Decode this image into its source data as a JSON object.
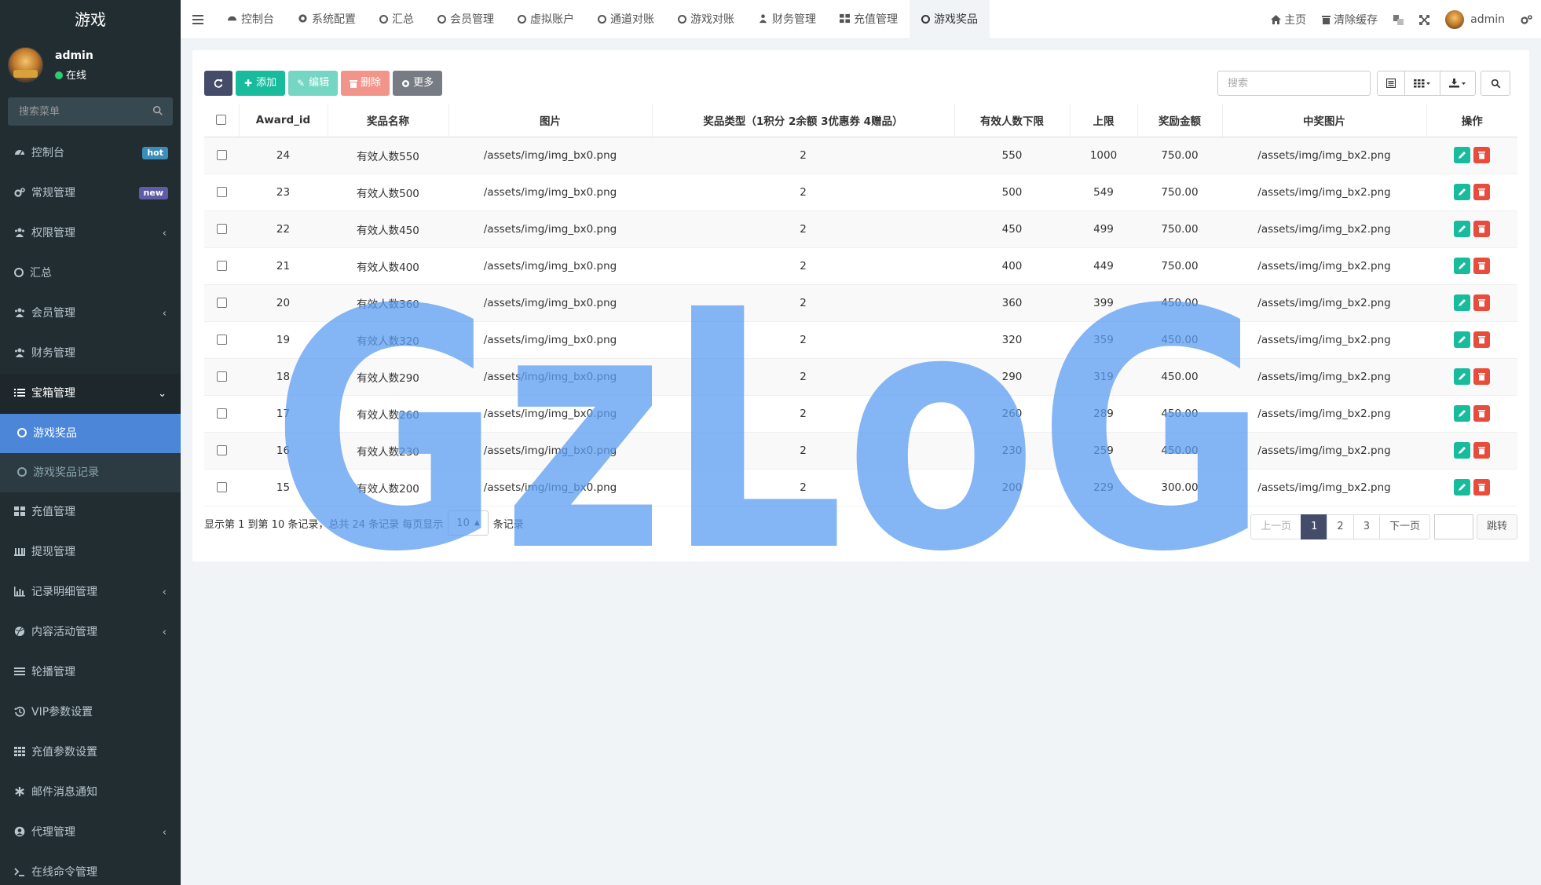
{
  "app": {
    "title": "游戏"
  },
  "user": {
    "name": "admin",
    "status": "在线"
  },
  "sidebar_search": {
    "placeholder": "搜索菜单"
  },
  "menu": {
    "items": [
      {
        "label": "控制台",
        "badge": "hot"
      },
      {
        "label": "常规管理",
        "badge": "new"
      },
      {
        "label": "权限管理"
      },
      {
        "label": "汇总"
      },
      {
        "label": "会员管理"
      },
      {
        "label": "财务管理"
      },
      {
        "label": "宝箱管理"
      },
      {
        "label": "充值管理"
      },
      {
        "label": "提现管理"
      },
      {
        "label": "记录明细管理"
      },
      {
        "label": "内容活动管理"
      },
      {
        "label": "轮播管理"
      },
      {
        "label": "VIP参数设置"
      },
      {
        "label": "充值参数设置"
      },
      {
        "label": "邮件消息通知"
      },
      {
        "label": "代理管理"
      },
      {
        "label": "在线命令管理"
      }
    ],
    "sub": [
      {
        "label": "游戏奖品"
      },
      {
        "label": "游戏奖品记录"
      }
    ]
  },
  "tabs": [
    {
      "label": "控制台"
    },
    {
      "label": "系统配置"
    },
    {
      "label": "汇总"
    },
    {
      "label": "会员管理"
    },
    {
      "label": "虚拟账户"
    },
    {
      "label": "通道对账"
    },
    {
      "label": "游戏对账"
    },
    {
      "label": "财务管理"
    },
    {
      "label": "充值管理"
    },
    {
      "label": "游戏奖品"
    }
  ],
  "topright": {
    "home": "主页",
    "clear_cache": "清除缓存",
    "user": "admin"
  },
  "toolbar": {
    "add": "添加",
    "edit": "编辑",
    "delete": "删除",
    "more": "更多"
  },
  "table_search": {
    "placeholder": "搜索"
  },
  "table": {
    "headers": [
      "Award_id",
      "奖品名称",
      "图片",
      "奖品类型（1积分 2余额 3优惠券 4赠品）",
      "有效人数下限",
      "上限",
      "奖励金额",
      "中奖图片",
      "操作"
    ],
    "rows": [
      [
        "24",
        "有效人数550",
        "/assets/img/img_bx0.png",
        "2",
        "550",
        "1000",
        "750.00",
        "/assets/img/img_bx2.png"
      ],
      [
        "23",
        "有效人数500",
        "/assets/img/img_bx0.png",
        "2",
        "500",
        "549",
        "750.00",
        "/assets/img/img_bx2.png"
      ],
      [
        "22",
        "有效人数450",
        "/assets/img/img_bx0.png",
        "2",
        "450",
        "499",
        "750.00",
        "/assets/img/img_bx2.png"
      ],
      [
        "21",
        "有效人数400",
        "/assets/img/img_bx0.png",
        "2",
        "400",
        "449",
        "750.00",
        "/assets/img/img_bx2.png"
      ],
      [
        "20",
        "有效人数360",
        "/assets/img/img_bx0.png",
        "2",
        "360",
        "399",
        "450.00",
        "/assets/img/img_bx2.png"
      ],
      [
        "19",
        "有效人数320",
        "/assets/img/img_bx0.png",
        "2",
        "320",
        "359",
        "450.00",
        "/assets/img/img_bx2.png"
      ],
      [
        "18",
        "有效人数290",
        "/assets/img/img_bx0.png",
        "2",
        "290",
        "319",
        "450.00",
        "/assets/img/img_bx2.png"
      ],
      [
        "17",
        "有效人数260",
        "/assets/img/img_bx0.png",
        "2",
        "260",
        "289",
        "450.00",
        "/assets/img/img_bx2.png"
      ],
      [
        "16",
        "有效人数230",
        "/assets/img/img_bx0.png",
        "2",
        "230",
        "259",
        "450.00",
        "/assets/img/img_bx2.png"
      ],
      [
        "15",
        "有效人数200",
        "/assets/img/img_bx0.png",
        "2",
        "200",
        "229",
        "300.00",
        "/assets/img/img_bx2.png"
      ]
    ]
  },
  "footer": {
    "info": "显示第 1 到第 10 条记录，总共 24 条记录 每页显示",
    "page_size": "10",
    "suffix": "条记录"
  },
  "pager": {
    "prev": "上一页",
    "pages": [
      "1",
      "2",
      "3"
    ],
    "next": "下一页",
    "go": "跳转"
  },
  "watermark": "GzLoG",
  "colors": {
    "sidebar_bg": "#222d32",
    "accent": "#18bc9c",
    "danger": "#e74c3c",
    "active_menu": "#4b86d9",
    "watermark": "#5b9cf0"
  }
}
